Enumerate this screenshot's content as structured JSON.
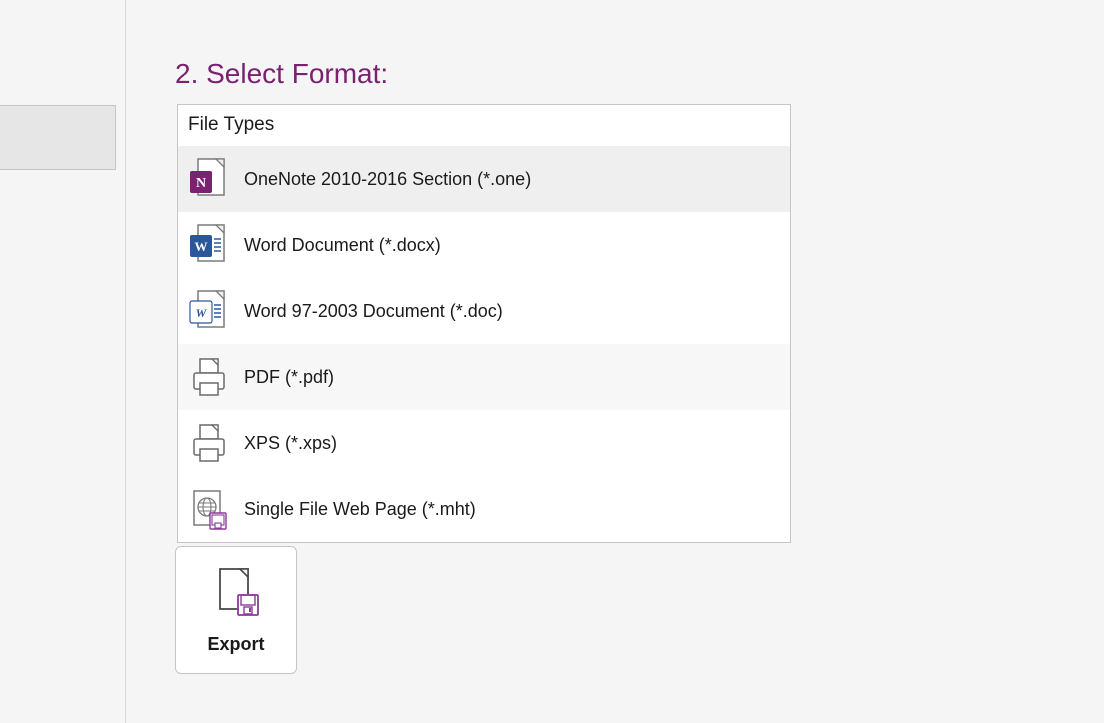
{
  "section_title": "2. Select Format:",
  "file_types_header": "File Types",
  "file_types": [
    {
      "label": "OneNote 2010-2016 Section (*.one)",
      "icon": "onenote",
      "selected": true
    },
    {
      "label": "Word Document (*.docx)",
      "icon": "word",
      "selected": false
    },
    {
      "label": "Word 97-2003 Document (*.doc)",
      "icon": "word97",
      "selected": false
    },
    {
      "label": "PDF (*.pdf)",
      "icon": "print",
      "selected": false,
      "highlight": true
    },
    {
      "label": "XPS (*.xps)",
      "icon": "print",
      "selected": false
    },
    {
      "label": "Single File Web Page (*.mht)",
      "icon": "mht",
      "selected": false
    }
  ],
  "export_button_label": "Export",
  "colors": {
    "accent": "#7a216f",
    "background": "#f5f5f5",
    "border": "#c5c5c5"
  }
}
